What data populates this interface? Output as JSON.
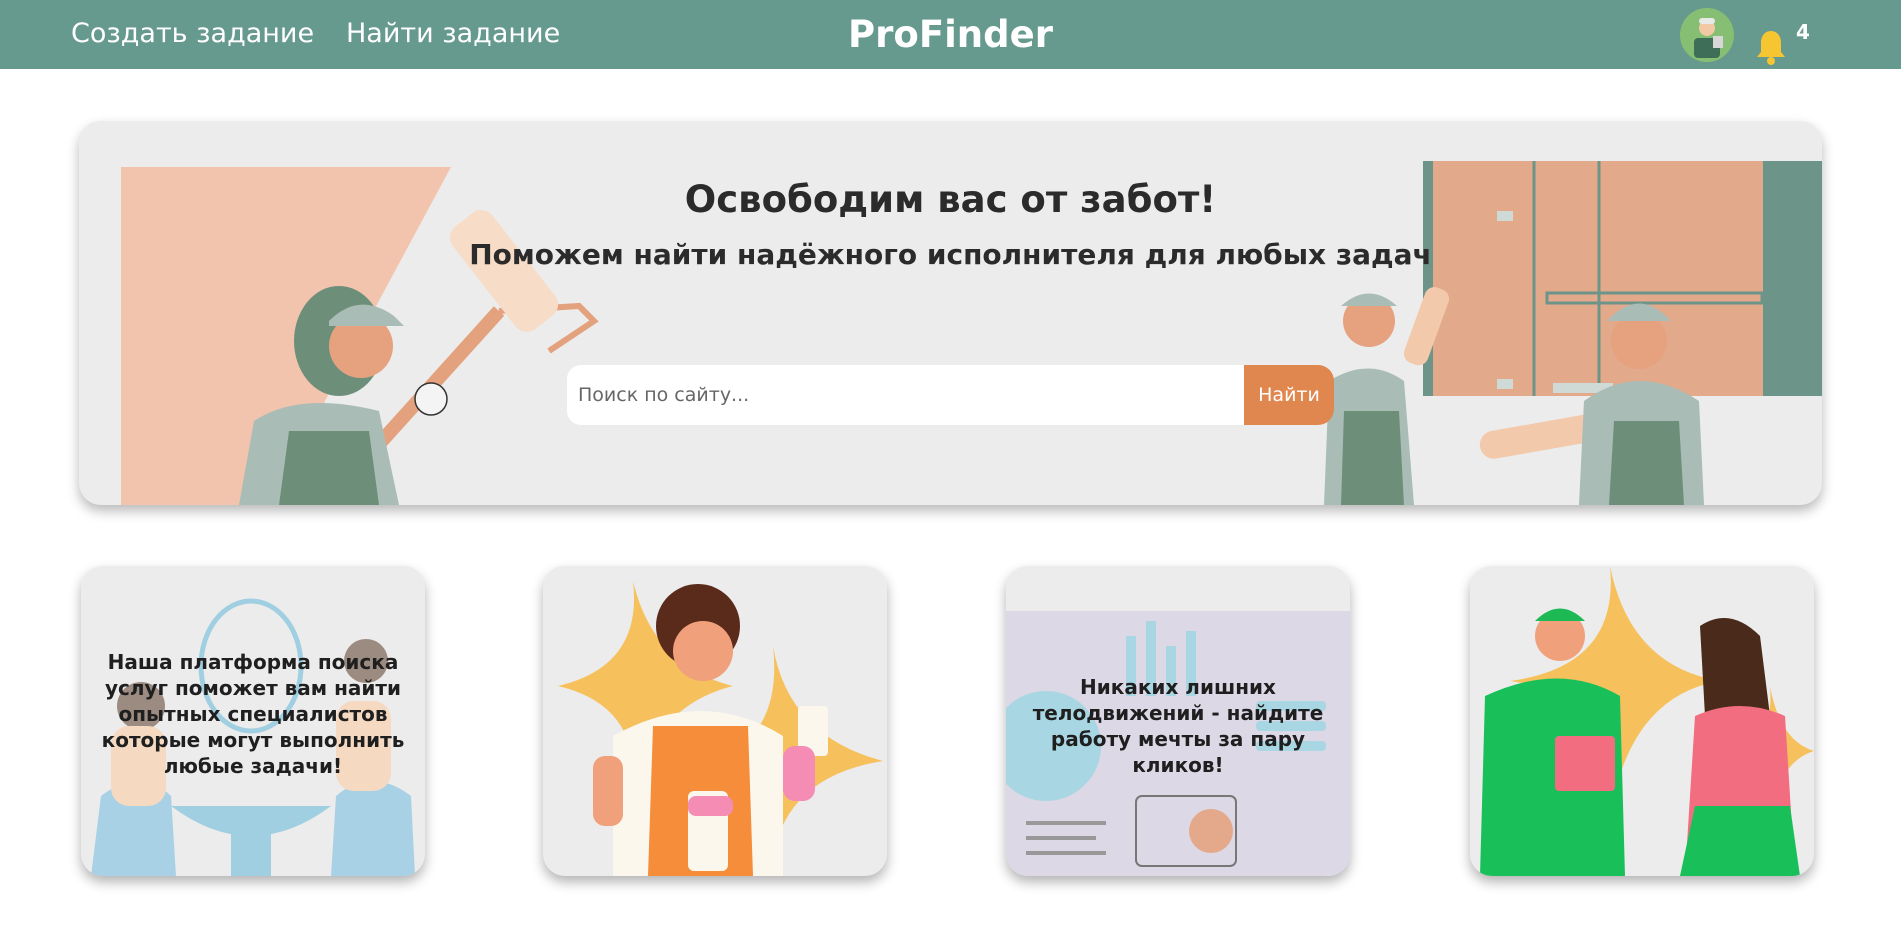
{
  "header": {
    "nav": {
      "create_task": "Создать задание",
      "find_task": "Найти задание"
    },
    "logo": "ProFinder",
    "notifications_count": "4"
  },
  "hero": {
    "title": "Освободим вас от забот!",
    "subtitle": "Поможем найти надёжного исполнителя для любых задач",
    "search": {
      "placeholder": "Поиск по сайту...",
      "value": "",
      "button_label": "Найти"
    }
  },
  "cards": [
    {
      "text": "Наша платформа поиска услуг поможет вам найти опытных специалистов которые могут выполнить любые задачи!"
    },
    {
      "text": ""
    },
    {
      "text": "Никаких лишних телодвижений - найдите работу мечты за пару кликов!"
    },
    {
      "text": ""
    }
  ],
  "colors": {
    "header_bg": "#679a8f",
    "accent": "#e0874f",
    "hero_bg": "#ececec",
    "bell": "#f6c532"
  },
  "icons": {
    "avatar": "user-avatar-icon",
    "bell": "bell-icon"
  }
}
